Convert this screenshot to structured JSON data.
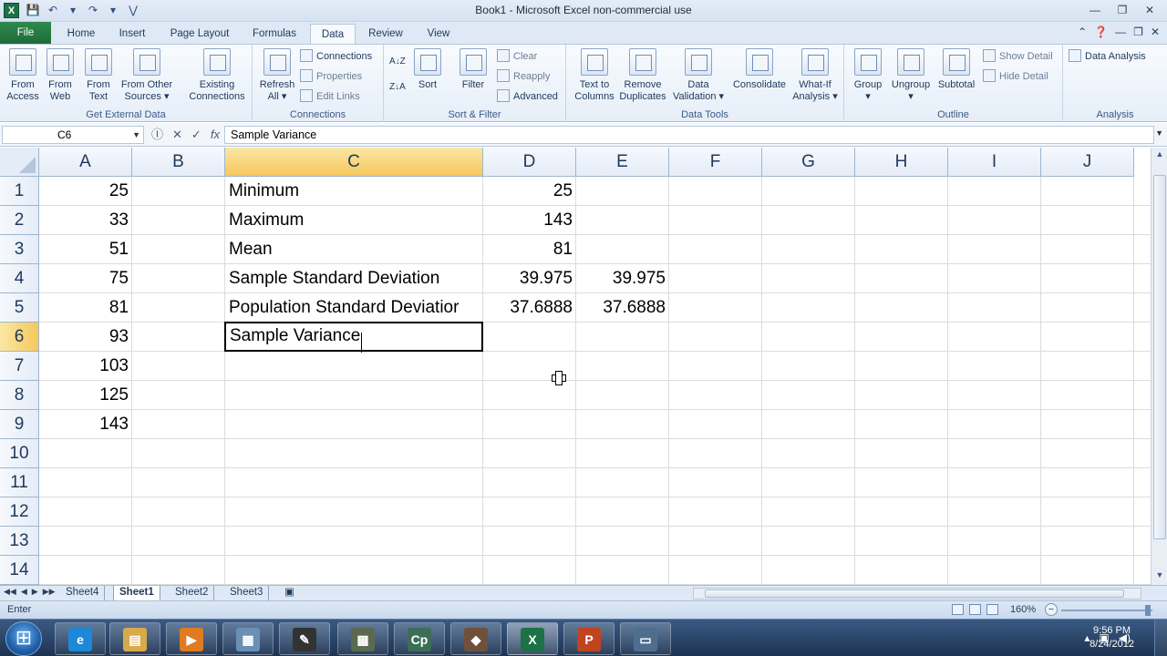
{
  "titlebar": {
    "app_icon": "excel-icon",
    "title": "Book1  -  Microsoft Excel non-commercial use",
    "qat": [
      "save-icon",
      "undo-icon",
      "dropdown-icon",
      "redo-icon",
      "dropdown-icon",
      "customize-icon"
    ],
    "window_buttons": [
      "minimize-icon",
      "restore-icon",
      "close-icon"
    ]
  },
  "tabs": {
    "file": "File",
    "items": [
      "Home",
      "Insert",
      "Page Layout",
      "Formulas",
      "Data",
      "Review",
      "View"
    ],
    "active": "Data",
    "right_icons": [
      "minimize-ribbon-icon",
      "help-icon",
      "doc-minimize-icon",
      "doc-restore-icon",
      "doc-close-icon"
    ]
  },
  "ribbon": {
    "get_external_data": {
      "label": "Get External Data",
      "from_access": [
        "From",
        "Access"
      ],
      "from_web": [
        "From",
        "Web"
      ],
      "from_text": [
        "From",
        "Text"
      ],
      "from_other": [
        "From Other",
        "Sources ▾"
      ],
      "existing": [
        "Existing",
        "Connections"
      ]
    },
    "connections": {
      "label": "Connections",
      "refresh": [
        "Refresh",
        "All ▾"
      ],
      "connections": "Connections",
      "properties": "Properties",
      "edit_links": "Edit Links"
    },
    "sort_filter": {
      "label": "Sort & Filter",
      "sort": "Sort",
      "filter": "Filter",
      "clear": "Clear",
      "reapply": "Reapply",
      "advanced": "Advanced",
      "az": "A↓Z",
      "za": "Z↓A",
      "az_box": "A Z"
    },
    "data_tools": {
      "label": "Data Tools",
      "text_to_columns": [
        "Text to",
        "Columns"
      ],
      "remove_duplicates": [
        "Remove",
        "Duplicates"
      ],
      "data_validation": [
        "Data",
        "Validation ▾"
      ],
      "consolidate": "Consolidate",
      "what_if": [
        "What-If",
        "Analysis ▾"
      ]
    },
    "outline": {
      "label": "Outline",
      "group": "Group",
      "ungroup": "Ungroup",
      "subtotal": "Subtotal",
      "show_detail": "Show Detail",
      "hide_detail": "Hide Detail",
      "dropdown_marks": [
        "▾",
        "▾"
      ]
    },
    "analysis": {
      "label": "Analysis",
      "data_analysis": "Data Analysis"
    }
  },
  "formula_bar": {
    "name_box": "C6",
    "value": "Sample Variance",
    "buttons": [
      "Ⓘ",
      "✕",
      "✓",
      "fx"
    ]
  },
  "grid": {
    "columns": [
      "A",
      "B",
      "C",
      "D",
      "E",
      "F",
      "G",
      "H",
      "I",
      "J"
    ],
    "rows": [
      "1",
      "2",
      "3",
      "4",
      "5",
      "6",
      "7",
      "8",
      "9",
      "10",
      "11",
      "12",
      "13",
      "14"
    ],
    "selected_column": "C",
    "selected_row": "6",
    "col_a": [
      "25",
      "33",
      "51",
      "75",
      "81",
      "93",
      "103",
      "125",
      "143"
    ],
    "col_c": [
      "Minimum",
      "Maximum",
      "Mean",
      "Sample Standard Deviation",
      "Population Standard Deviatior"
    ],
    "col_d": [
      "25",
      "143",
      "81",
      "39.975",
      "37.6888"
    ],
    "col_e": [
      "",
      "",
      "",
      "39.975",
      "37.6888"
    ],
    "active_cell_text": "Sample Variance"
  },
  "sheets": {
    "tabs": [
      "Sheet4",
      "Sheet1",
      "Sheet2",
      "Sheet3"
    ],
    "active": "Sheet1",
    "nav": [
      "◀◀",
      "◀",
      "▶",
      "▶▶"
    ]
  },
  "status": {
    "mode": "Enter",
    "zoom": "160%",
    "zoom_minus": "−"
  },
  "taskbar": {
    "apps": [
      {
        "name": "internet-explorer",
        "glyph": "e",
        "color": "#1e88d8"
      },
      {
        "name": "file-explorer",
        "glyph": "▤",
        "color": "#d9a94a"
      },
      {
        "name": "media-player",
        "glyph": "▶",
        "color": "#e07b1f"
      },
      {
        "name": "network-tool",
        "glyph": "▦",
        "color": "#6a8fb5"
      },
      {
        "name": "pen-tool",
        "glyph": "✎",
        "color": "#333333"
      },
      {
        "name": "calculator",
        "glyph": "▩",
        "color": "#5a6a50"
      },
      {
        "name": "captivate",
        "glyph": "Cp",
        "color": "#3c6e57"
      },
      {
        "name": "game-app",
        "glyph": "◆",
        "color": "#70503a"
      },
      {
        "name": "excel",
        "glyph": "X",
        "color": "#1e7145"
      },
      {
        "name": "powerpoint",
        "glyph": "P",
        "color": "#c0441f"
      },
      {
        "name": "notepad",
        "glyph": "▭",
        "color": "#4f6e8f"
      }
    ],
    "tray_icons": [
      "▴",
      "▣",
      "◀)"
    ],
    "time": "9:56 PM",
    "date": "8/24/2012"
  }
}
